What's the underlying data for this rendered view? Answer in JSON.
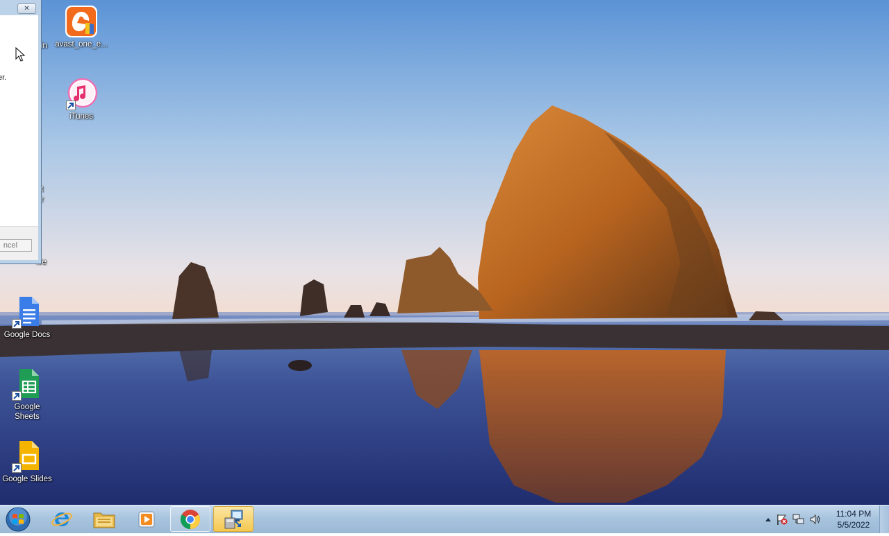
{
  "desktop": {
    "icons": [
      {
        "id": "avast",
        "label": "avast_one_e...",
        "icon": "avast-icon",
        "shortcut": false
      },
      {
        "id": "itunes",
        "label": "iTunes",
        "icon": "itunes-icon",
        "shortcut": true
      },
      {
        "id": "google-docs",
        "label": "Google Docs",
        "icon": "google-docs-icon",
        "shortcut": true
      },
      {
        "id": "google-sheets",
        "label": "Google Sheets",
        "icon": "google-sheets-icon",
        "shortcut": true
      },
      {
        "id": "google-slides",
        "label": "Google Slides",
        "icon": "google-slides-icon",
        "shortcut": true
      }
    ],
    "partial_labels": [
      "in",
      "t",
      "r",
      "ive"
    ]
  },
  "dialog": {
    "close_glyph": "✕",
    "text": "ter.",
    "cancel_label": "ncel"
  },
  "taskbar": {
    "start_icon": "windows-orb-icon",
    "pinned": [
      {
        "id": "ie",
        "icon": "internet-explorer-icon"
      },
      {
        "id": "explorer",
        "icon": "file-explorer-icon"
      },
      {
        "id": "media",
        "icon": "media-player-icon"
      },
      {
        "id": "chrome",
        "icon": "chrome-icon",
        "state": "open"
      },
      {
        "id": "installer",
        "icon": "installer-icon",
        "state": "active"
      }
    ],
    "tray": {
      "icons": [
        "show-hidden-icons-icon",
        "action-center-flag-icon",
        "network-icon",
        "volume-icon"
      ]
    },
    "clock": {
      "time": "11:04 PM",
      "date": "5/5/2022"
    }
  },
  "colors": {
    "sky_top": "#5b93d6",
    "sky_bottom": "#f2ddd4",
    "rock": "#c46f2a",
    "water": "#2e3f82",
    "taskbar": "#a8c4de"
  }
}
